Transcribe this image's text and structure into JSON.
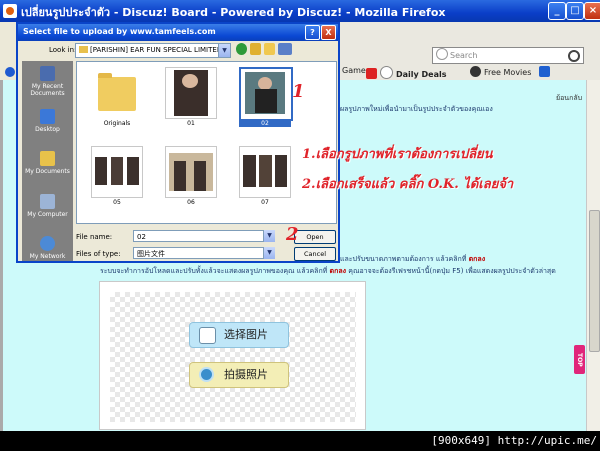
{
  "browser": {
    "title": "เปลี่ยนรูปประจำตัว - Discuz! Board - Powered by Discuz! - Mozilla Firefox",
    "search_placeholder": "Search",
    "bookmarks": [
      {
        "label": "Games",
        "bold": false
      },
      {
        "label": "Daily Deals",
        "bold": true
      },
      {
        "label": "Free Movies",
        "bold": false
      }
    ]
  },
  "page": {
    "back_link": "ย้อนกลับ",
    "line_top": "ผลรูปภาพใหม่เพื่อนำมาเป็นรูปประจำตัวของคุณเอง",
    "line_1_prefix": "และปรับขนาดภาพตามต้องการ แล้วคลิกที่",
    "line_1_bold": "ตกลง",
    "line_2_prefix": "ระบบจะทำการอัปโหลดและปรับทั้งแล้วจะแสดงผลรูปภาพของคุณ แล้วคลิกที่",
    "line_2_bold": "ตกลง",
    "line_2_suffix": "คุณอาจจะต้องรีเฟรชหน้านี้(กดปุ่ม F5) เพื่อแสดงผลรูปประจำตัวล่าสุด",
    "select_button": "选择图片",
    "camera_button": "拍摄照片",
    "top_tag": "TOP"
  },
  "dialog": {
    "title": "Select file to upload by www.tamfeels.com",
    "look_in_label": "Look in:",
    "look_in_value": "[PARISHIN] EAR FUN SPECIAL LIMITED ED",
    "places": [
      "My Recent Documents",
      "Desktop",
      "My Documents",
      "My Computer",
      "My Network"
    ],
    "files": [
      {
        "name": "Originals",
        "kind": "folder",
        "selected": false
      },
      {
        "name": "01",
        "kind": "photo",
        "selected": false
      },
      {
        "name": "02",
        "kind": "photo",
        "selected": true
      },
      {
        "name": "05",
        "kind": "photo",
        "selected": false
      },
      {
        "name": "06",
        "kind": "photo",
        "selected": false
      },
      {
        "name": "07",
        "kind": "photo",
        "selected": false
      }
    ],
    "file_name_label": "File name:",
    "file_name_value": "02",
    "file_type_label": "Files of type:",
    "file_type_value": "图片文件",
    "open_button": "Open",
    "cancel_button": "Cancel",
    "help_button": "?",
    "close_button": "X"
  },
  "annotations": {
    "step_1_marker": "1",
    "step_2_marker": "2",
    "step_1_text": "1.เลือกรูปภาพที่เราต้องการเปลี่ยน",
    "step_2_text": "2.เลือกเสร็จแล้ว คลิ๊ก O.K. ได้เลยจ้า",
    "color": "#e0232a"
  },
  "watermark": "[900x649] http://upic.me/"
}
